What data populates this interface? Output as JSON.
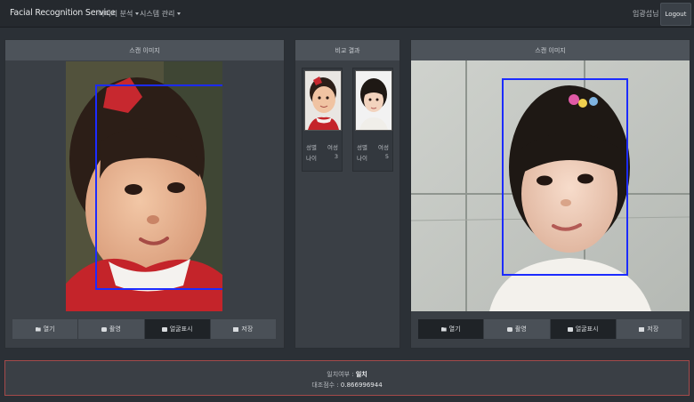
{
  "nav": {
    "brand": "Facial Recognition Service",
    "menu_image_analysis": "이미지 분석",
    "menu_system": "시스템 관리",
    "user_greeting": "임광섭님",
    "logout": "Logout"
  },
  "left_panel": {
    "title": "스캔 이미지",
    "buttons": {
      "open": "열기",
      "capture": "촬영",
      "face": "얼굴표시",
      "save": "저장"
    }
  },
  "middle_panel": {
    "title": "비교 결과",
    "cards": [
      {
        "gender_label": "성별",
        "gender": "여성",
        "age_label": "나이",
        "age": "3"
      },
      {
        "gender_label": "성별",
        "gender": "여성",
        "age_label": "나이",
        "age": "5"
      }
    ]
  },
  "right_panel": {
    "title": "스캔 이미지",
    "buttons": {
      "open": "열기",
      "capture": "촬영",
      "face": "얼굴표시",
      "save": "저장"
    }
  },
  "result": {
    "match_label": "일치여부 : ",
    "match_value": "일치",
    "score_label": "대조점수 : ",
    "score_value": "0.866996944"
  },
  "colors": {
    "face_box": "#1c2bff",
    "result_border": "#a44a4a",
    "nav_bg": "#25292e"
  }
}
